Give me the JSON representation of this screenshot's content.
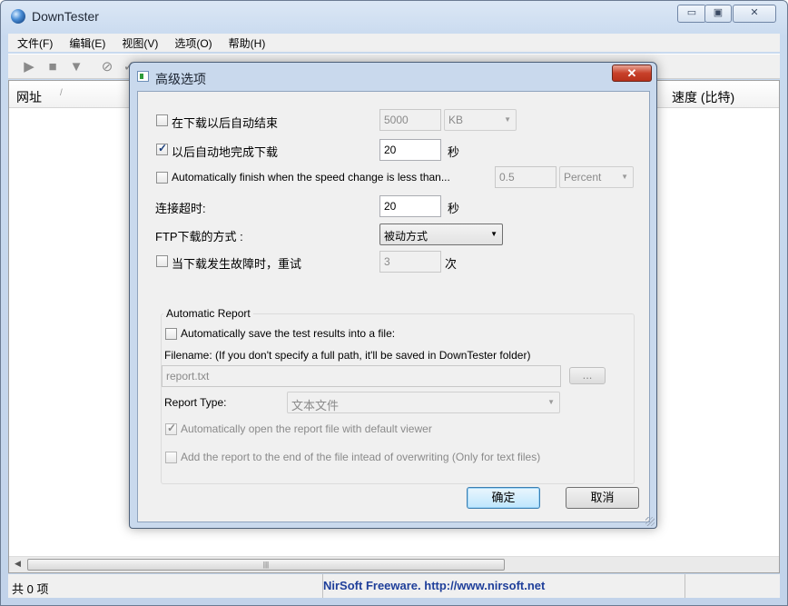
{
  "app": {
    "title": "DownTester",
    "caption_buttons": {
      "minimize": "▭",
      "maximize": "▣",
      "close": "✕"
    }
  },
  "menu": [
    "文件(F)",
    "编辑(E)",
    "视图(V)",
    "选项(O)",
    "帮助(H)"
  ],
  "toolbar": {
    "icons": [
      "play-icon",
      "stop-icon",
      "filter-icon",
      "cancel-icon",
      "check-icon"
    ]
  },
  "list": {
    "columns": {
      "url": "网址",
      "speed": "速度 (比特)"
    }
  },
  "status": {
    "count": "共 0 项",
    "credit": "NirSoft Freeware.  http://www.nirsoft.net"
  },
  "dialog": {
    "title": "高级选项",
    "close_label": "✕",
    "auto_end": {
      "label": "在下载以后自动结束",
      "checked": false,
      "value": "5000",
      "unit": "KB"
    },
    "auto_complete": {
      "label": "以后自动地完成下载",
      "checked": true,
      "value": "20",
      "unit": "秒"
    },
    "speed_change": {
      "label": "Automatically finish when the speed change is less than...",
      "checked": false,
      "value": "0.5",
      "unit": "Percent"
    },
    "timeout": {
      "label": "连接超时:",
      "value": "20",
      "unit": "秒"
    },
    "ftp_mode": {
      "label": "FTP下载的方式 :",
      "value": "被动方式"
    },
    "retry": {
      "label": "当下载发生故障时，重试",
      "checked": false,
      "value": "3",
      "unit": "次"
    },
    "report": {
      "group_title": "Automatic Report",
      "save_label": "Automatically save the test results into a file:",
      "save_checked": false,
      "filename_label": "Filename: (If you don't specify a full path, it'll be saved in DownTester folder)",
      "filename_value": "report.txt",
      "browse_label": "...",
      "type_label": "Report Type:",
      "type_value": "文本文件",
      "open_label": "Automatically open the report file with default viewer",
      "open_checked": true,
      "append_label": "Add the report to the end of the file intead of overwriting (Only for text files)",
      "append_checked": false
    },
    "ok_label": "确定",
    "cancel_label": "取消"
  }
}
